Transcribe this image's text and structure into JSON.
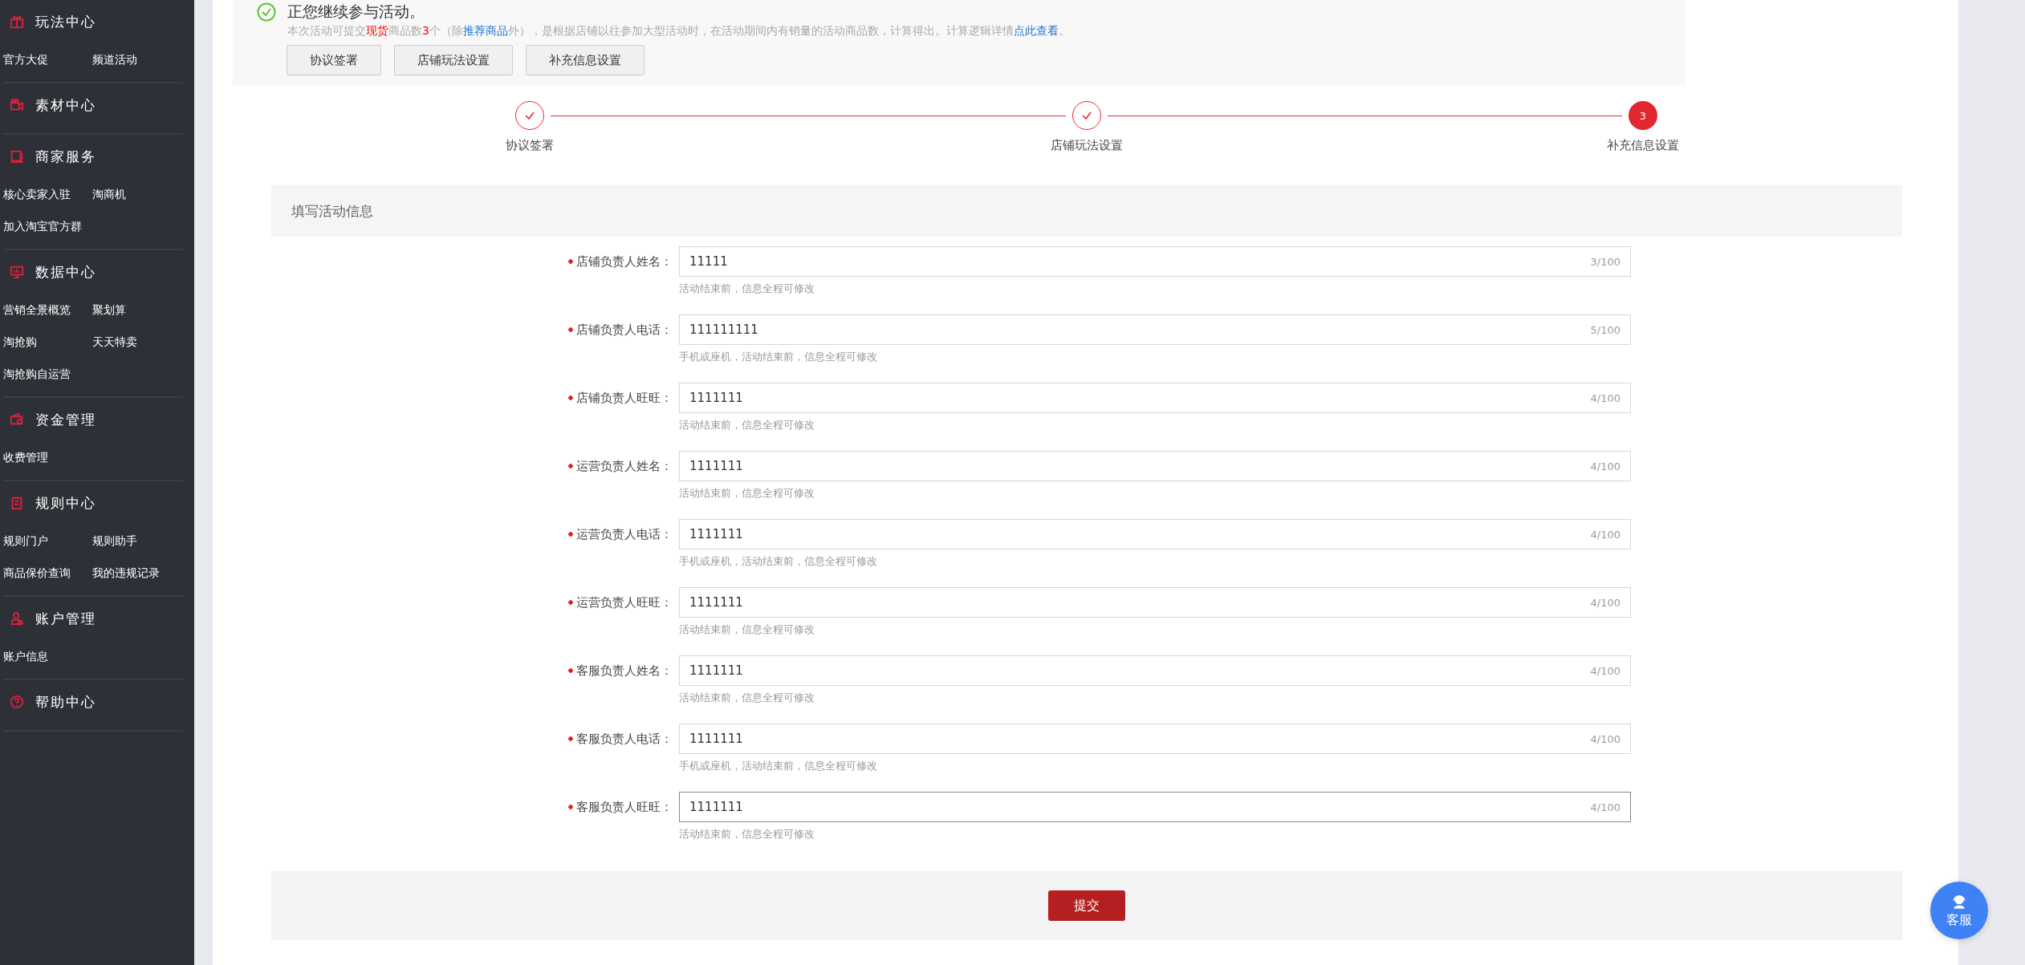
{
  "sidebar": {
    "sections": [
      {
        "title": "玩法中心",
        "items": [
          "官方大促",
          "频道活动"
        ]
      },
      {
        "title": "素材中心"
      },
      {
        "title": "商家服务",
        "items": [
          "核心卖家入驻",
          "淘商机",
          "加入淘宝官方群"
        ]
      },
      {
        "title": "数据中心",
        "items": [
          "营销全景概览",
          "聚划算",
          "淘抢购",
          "天天特卖",
          "淘抢购自运营"
        ]
      },
      {
        "title": "资金管理",
        "items": [
          "收费管理"
        ]
      },
      {
        "title": "规则中心",
        "items": [
          "规则门户",
          "规则助手",
          "商品保价查询",
          "我的违规记录"
        ]
      },
      {
        "title": "账户管理",
        "items": [
          "账户信息"
        ]
      },
      {
        "title": "帮助中心"
      }
    ]
  },
  "banner": {
    "title": "正您继续参与活动。",
    "notice": [
      {
        "kind": "text",
        "text": "本次活动可提交"
      },
      {
        "kind": "red",
        "text": "现货"
      },
      {
        "kind": "text",
        "text": "商品数"
      },
      {
        "kind": "red",
        "text": "3"
      },
      {
        "kind": "text",
        "text": "个（除"
      },
      {
        "kind": "blue",
        "text": "推荐商品"
      },
      {
        "kind": "text",
        "text": "外），是根据店铺以往参加大型活动时，在活动期间内有销量的活动商品数，计算得出。计算逻辑详情"
      },
      {
        "kind": "link",
        "text": "点此查看"
      },
      {
        "kind": "text",
        "text": "。"
      }
    ],
    "buttons": [
      "协议签署",
      "店铺玩法设置",
      "补充信息设置"
    ]
  },
  "steps": [
    {
      "label": "协议签署",
      "done": true
    },
    {
      "label": "店铺玩法设置",
      "done": true
    },
    {
      "label": "补充信息设置",
      "done": false,
      "number": "3"
    }
  ],
  "form": {
    "title": "填写活动信息",
    "fields": [
      {
        "label": "店铺负责人姓名：",
        "required": true,
        "value": "11111",
        "count": "3/100",
        "hint": "活动结束前，信息全程可修改",
        "focused": false
      },
      {
        "label": "店铺负责人电话：",
        "required": true,
        "value": "111111111",
        "count": "5/100",
        "hint": "手机或座机，活动结束前，信息全程可修改",
        "focused": false
      },
      {
        "label": "店铺负责人旺旺：",
        "required": true,
        "value": "1111111",
        "count": "4/100",
        "hint": "活动结束前，信息全程可修改",
        "focused": false
      },
      {
        "label": "运营负责人姓名：",
        "required": true,
        "value": "1111111",
        "count": "4/100",
        "hint": "活动结束前，信息全程可修改",
        "focused": false
      },
      {
        "label": "运营负责人电话：",
        "required": true,
        "value": "1111111",
        "count": "4/100",
        "hint": "手机或座机，活动结束前，信息全程可修改",
        "focused": false
      },
      {
        "label": "运营负责人旺旺：",
        "required": true,
        "value": "1111111",
        "count": "4/100",
        "hint": "活动结束前，信息全程可修改",
        "focused": false
      },
      {
        "label": "客服负责人姓名：",
        "required": true,
        "value": "1111111",
        "count": "4/100",
        "hint": "活动结束前，信息全程可修改",
        "focused": false
      },
      {
        "label": "客服负责人电话：",
        "required": true,
        "value": "1111111",
        "count": "4/100",
        "hint": "手机或座机，活动结束前，信息全程可修改",
        "focused": false
      },
      {
        "label": "客服负责人旺旺：",
        "required": true,
        "value": "1111111",
        "count": "4/100",
        "hint": "活动结束前，信息全程可修改",
        "focused": true
      }
    ],
    "submit": "提交"
  },
  "support": {
    "label": "客服"
  }
}
